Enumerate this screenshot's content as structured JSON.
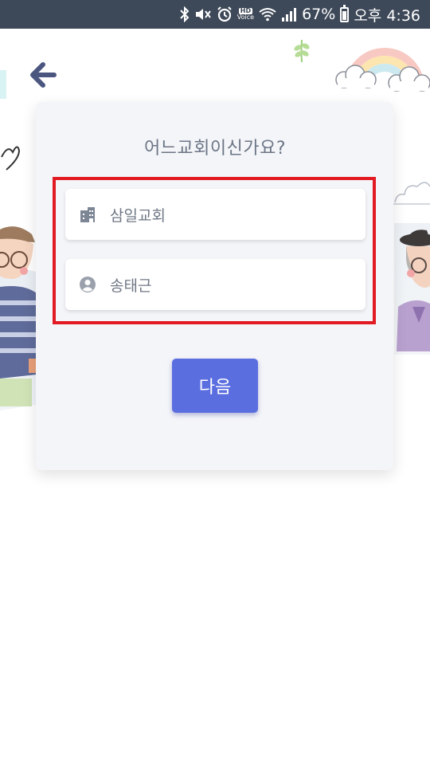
{
  "status_bar": {
    "battery_percent": "67%",
    "time": "오후 4:36",
    "hd_top": "HD",
    "hd_bottom": "Voice",
    "icons": [
      "bluetooth-icon",
      "mute-icon",
      "alarm-icon",
      "hd-voice-icon",
      "wifi-icon",
      "signal-icon",
      "battery-icon"
    ],
    "battery_level": 0.67,
    "background": "#3d4858"
  },
  "header": {
    "back_icon": "arrow-left-icon"
  },
  "card": {
    "title": "어느교회이신가요?",
    "church_field": {
      "icon": "building-icon",
      "value": "삼일교회"
    },
    "name_field": {
      "icon": "user-circle-icon",
      "value": "송태근"
    },
    "next_button": {
      "label": "다음",
      "color": "#5b6ee0"
    }
  },
  "highlight_color": "#e21a23"
}
